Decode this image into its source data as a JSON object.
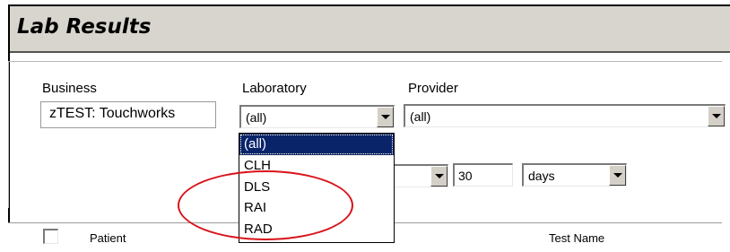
{
  "header": {
    "title": "Lab Results"
  },
  "filters": {
    "business": {
      "label": "Business",
      "value": "zTEST: Touchworks"
    },
    "laboratory": {
      "label": "Laboratory",
      "value": "(all)",
      "options": [
        "(all)",
        "CLH",
        "DLS",
        "RAI",
        "RAD"
      ],
      "selected_index": 0,
      "open": true
    },
    "provider": {
      "label": "Provider",
      "value": "(all)"
    },
    "range": {
      "amount": "30",
      "unit": "days"
    }
  },
  "table": {
    "columns": [
      "Patient",
      "Test Name"
    ]
  },
  "annotation": {
    "color": "#d8131a"
  }
}
